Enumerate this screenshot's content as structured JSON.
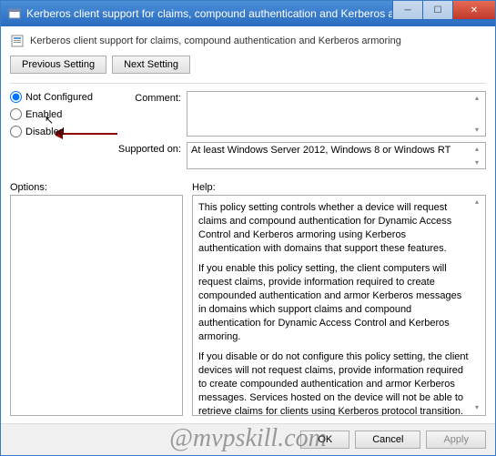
{
  "titlebar": {
    "title": "Kerberos client support for claims, compound authentication and Kerberos armoring"
  },
  "header": {
    "text": "Kerberos client support for claims, compound authentication and Kerberos armoring"
  },
  "buttons": {
    "previous": "Previous Setting",
    "next": "Next Setting",
    "ok": "OK",
    "cancel": "Cancel",
    "apply": "Apply"
  },
  "radio": {
    "not_configured": "Not Configured",
    "enabled": "Enabled",
    "disabled": "Disabled",
    "selected": "not_configured"
  },
  "labels": {
    "comment": "Comment:",
    "supported_on": "Supported on:",
    "options": "Options:",
    "help": "Help:"
  },
  "fields": {
    "comment": "",
    "supported_on": "At least Windows Server 2012, Windows 8 or Windows RT"
  },
  "help": {
    "p1": "This policy setting controls whether a device will request claims and compound authentication for Dynamic Access Control and Kerberos armoring using Kerberos authentication with domains that support these features.",
    "p2": "If you enable this policy setting, the client computers will request claims, provide information required to create compounded authentication and armor Kerberos messages in domains which support claims and compound authentication for Dynamic Access Control and Kerberos armoring.",
    "p3": "If you disable or do not configure this policy setting, the client devices will not request claims, provide information required to create compounded authentication and armor Kerberos messages. Services hosted on the device will not be able to retrieve claims for clients using Kerberos protocol transition."
  },
  "watermark": "@mvpskill.com"
}
